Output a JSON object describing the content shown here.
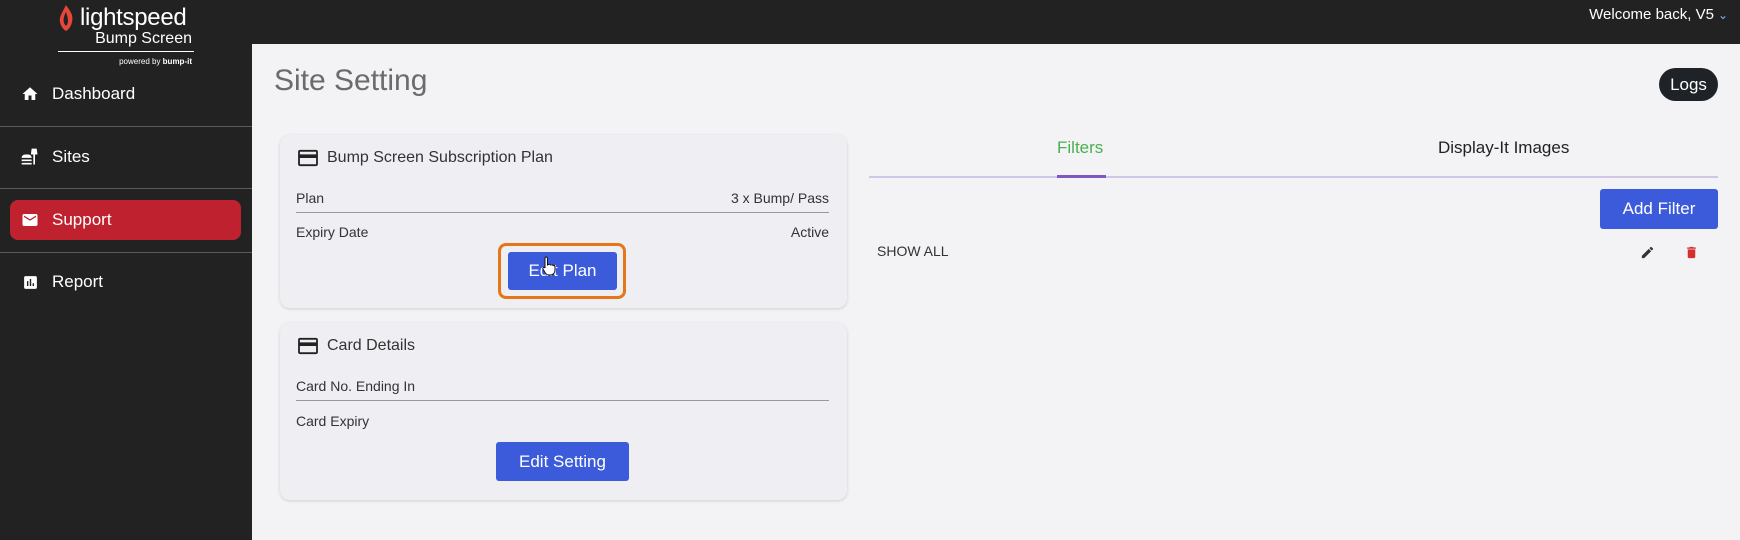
{
  "header": {
    "welcome": "Welcome back, V5"
  },
  "logo": {
    "brand": "lightspeed",
    "product": "Bump Screen",
    "powered_prefix": "powered by",
    "powered_brand": "bump-it"
  },
  "sidebar": {
    "items": [
      {
        "label": "Dashboard",
        "icon": "home-icon"
      },
      {
        "label": "Sites",
        "icon": "sites-icon"
      },
      {
        "label": "Support",
        "icon": "mail-icon",
        "active": true
      },
      {
        "label": "Report",
        "icon": "report-icon"
      }
    ]
  },
  "page": {
    "title": "Site Setting",
    "logs_label": "Logs"
  },
  "subscription": {
    "title": "Bump Screen Subscription Plan",
    "plan_label": "Plan",
    "plan_value": "3 x Bump/ Pass",
    "expiry_label": "Expiry Date",
    "expiry_value": "Active",
    "edit_label": "Edit Plan"
  },
  "card_details": {
    "title": "Card Details",
    "card_no_label": "Card No. Ending In",
    "card_expiry_label": "Card Expiry",
    "edit_label": "Edit Setting"
  },
  "filters": {
    "tabs": [
      "Filters",
      "Display-It Images"
    ],
    "active_tab": "Filters",
    "add_label": "Add Filter",
    "rows": [
      {
        "name": "SHOW ALL"
      }
    ]
  },
  "colors": {
    "sidebar_bg": "#222222",
    "active_nav": "#c0212e",
    "primary_button": "#3b5bdb",
    "focus_ring": "#e6761a",
    "active_tab_text": "#4caf50",
    "tab_indicator": "#7e57c2",
    "delete_icon": "#d32f2f"
  }
}
